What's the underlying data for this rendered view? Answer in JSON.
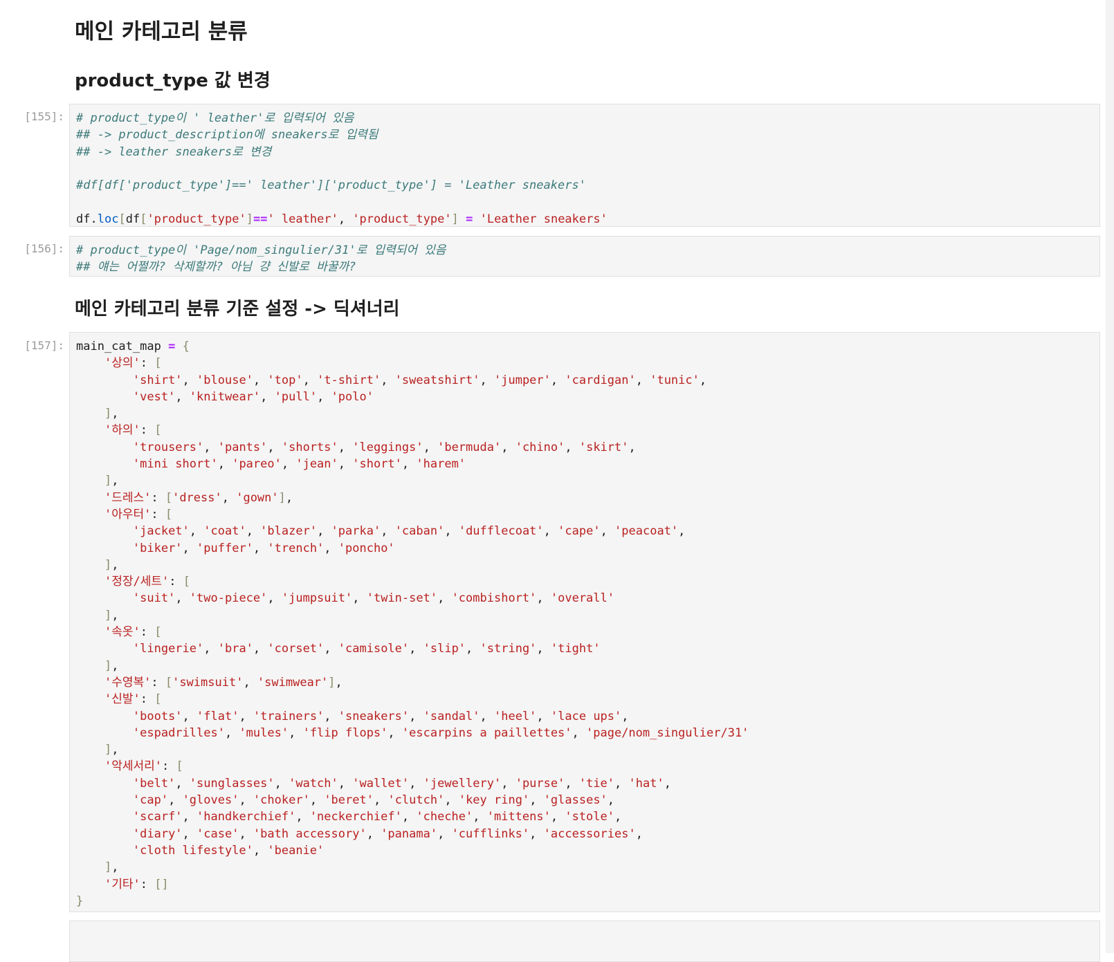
{
  "headings": {
    "main": "메인 카테고리 분류",
    "product_type": "product_type 값 변경",
    "dict": "메인 카테고리 분류 기준 설정 -> 딕셔너리"
  },
  "prompts": {
    "c155": "[155]:",
    "c156": "[156]:",
    "c157": "[157]:"
  },
  "cell155": {
    "comment1": "# product_type이 ' leather'로 입력되어 있음",
    "comment2": "## -> product_description에 sneakers로 입력됨",
    "comment3": "## -> leather sneakers로 변경",
    "comment4": "#df[df['product_type']==' leather']['product_type'] = 'Leather sneakers'",
    "code": {
      "df": "df",
      "loc": "loc",
      "df2": "df",
      "key1": "'product_type'",
      "eq": "==",
      "val1": "' leather'",
      "key2": "'product_type'",
      "assign": "=",
      "val2": "'Leather sneakers'"
    }
  },
  "cell156": {
    "comment1": "# product_type이 'Page/nom_singulier/31'로 입력되어 있음",
    "comment2": "## 얘는 어쩔까? 삭제할까? 아님 걍 신발로 바꿀까?"
  },
  "cell157": {
    "var": "main_cat_map",
    "categories": [
      {
        "key": "'상의'",
        "lines": [
          [
            "'shirt'",
            "'blouse'",
            "'top'",
            "'t-shirt'",
            "'sweatshirt'",
            "'jumper'",
            "'cardigan'",
            "'tunic'"
          ],
          [
            "'vest'",
            "'knitwear'",
            "'pull'",
            "'polo'"
          ]
        ]
      },
      {
        "key": "'하의'",
        "lines": [
          [
            "'trousers'",
            "'pants'",
            "'shorts'",
            "'leggings'",
            "'bermuda'",
            "'chino'",
            "'skirt'"
          ],
          [
            "'mini short'",
            "'pareo'",
            "'jean'",
            "'short'",
            "'harem'"
          ]
        ]
      },
      {
        "key": "'드레스'",
        "inline": [
          "'dress'",
          "'gown'"
        ]
      },
      {
        "key": "'아우터'",
        "lines": [
          [
            "'jacket'",
            "'coat'",
            "'blazer'",
            "'parka'",
            "'caban'",
            "'dufflecoat'",
            "'cape'",
            "'peacoat'"
          ],
          [
            "'biker'",
            "'puffer'",
            "'trench'",
            "'poncho'"
          ]
        ]
      },
      {
        "key": "'정장/세트'",
        "lines": [
          [
            "'suit'",
            "'two-piece'",
            "'jumpsuit'",
            "'twin-set'",
            "'combishort'",
            "'overall'"
          ]
        ]
      },
      {
        "key": "'속옷'",
        "lines": [
          [
            "'lingerie'",
            "'bra'",
            "'corset'",
            "'camisole'",
            "'slip'",
            "'string'",
            "'tight'"
          ]
        ]
      },
      {
        "key": "'수영복'",
        "inline": [
          "'swimsuit'",
          "'swimwear'"
        ]
      },
      {
        "key": "'신발'",
        "lines": [
          [
            "'boots'",
            "'flat'",
            "'trainers'",
            "'sneakers'",
            "'sandal'",
            "'heel'",
            "'lace ups'"
          ],
          [
            "'espadrilles'",
            "'mules'",
            "'flip flops'",
            "'escarpins a paillettes'",
            "'page/nom_singulier/31'"
          ]
        ]
      },
      {
        "key": "'악세서리'",
        "lines": [
          [
            "'belt'",
            "'sunglasses'",
            "'watch'",
            "'wallet'",
            "'jewellery'",
            "'purse'",
            "'tie'",
            "'hat'"
          ],
          [
            "'cap'",
            "'gloves'",
            "'choker'",
            "'beret'",
            "'clutch'",
            "'key ring'",
            "'glasses'"
          ],
          [
            "'scarf'",
            "'handkerchief'",
            "'neckerchief'",
            "'cheche'",
            "'mittens'",
            "'stole'"
          ],
          [
            "'diary'",
            "'case'",
            "'bath accessory'",
            "'panama'",
            "'cufflinks'",
            "'accessories'"
          ],
          [
            "'cloth lifestyle'",
            "'beanie'"
          ]
        ]
      },
      {
        "key": "'기타'",
        "inline": []
      }
    ]
  }
}
